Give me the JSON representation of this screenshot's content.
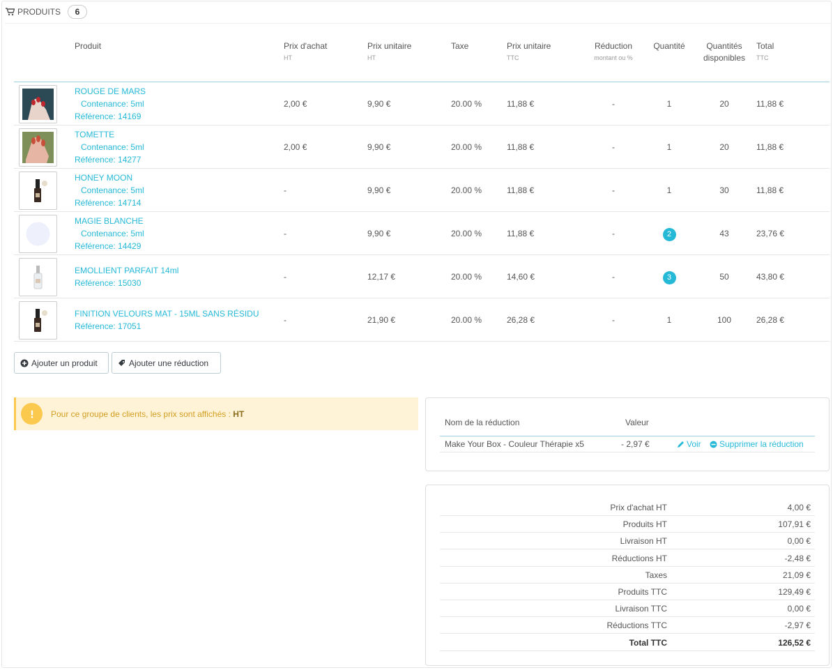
{
  "panel": {
    "title": "Produits",
    "count": "6"
  },
  "columns": {
    "product": "Produit",
    "purchase_price": "Prix d'achat",
    "purchase_price_sub": "HT",
    "unit_price_ht": "Prix unitaire",
    "unit_price_ht_sub": "HT",
    "tax": "Taxe",
    "unit_price_ttc": "Prix unitaire",
    "unit_price_ttc_sub": "TTC",
    "reduction": "Réduction",
    "reduction_sub": "montant ou %",
    "quantity": "Quantité",
    "available": "Quantités disponibles",
    "total": "Total",
    "total_sub": "TTC"
  },
  "products": [
    {
      "name": "ROUGE DE MARS",
      "variant": "Contenance: 5ml",
      "reference": "Référence: 14169",
      "purchase": "2,00 €",
      "unit_ht": "9,90 €",
      "tax": "20.00 %",
      "unit_ttc": "11,88 €",
      "reduction": "-",
      "qty": "1",
      "available": "20",
      "total": "11,88 €",
      "image": "nails-red"
    },
    {
      "name": "TOMETTE",
      "variant": "Contenance: 5ml",
      "reference": "Référence: 14277",
      "purchase": "2,00 €",
      "unit_ht": "9,90 €",
      "tax": "20.00 %",
      "unit_ttc": "11,88 €",
      "reduction": "-",
      "qty": "1",
      "available": "20",
      "total": "11,88 €",
      "image": "nails-terracotta"
    },
    {
      "name": "HONEY MOON",
      "variant": "Contenance: 5ml",
      "reference": "Référence: 14714",
      "purchase": "-",
      "unit_ht": "9,90 €",
      "tax": "20.00 %",
      "unit_ttc": "11,88 €",
      "reduction": "-",
      "qty": "1",
      "available": "30",
      "total": "11,88 €",
      "image": "bottle-dark"
    },
    {
      "name": "MAGIE BLANCHE",
      "variant": "Contenance: 5ml",
      "reference": "Référence: 14429",
      "purchase": "-",
      "unit_ht": "9,90 €",
      "tax": "20.00 %",
      "unit_ttc": "11,88 €",
      "reduction": "-",
      "qty": "2",
      "available": "43",
      "total": "23,76 €",
      "image": "white-disc"
    },
    {
      "name": "EMOLLIENT PARFAIT 14ml",
      "variant": "",
      "reference": "Référence: 15030",
      "purchase": "-",
      "unit_ht": "12,17 €",
      "tax": "20.00 %",
      "unit_ttc": "14,60 €",
      "reduction": "-",
      "qty": "3",
      "available": "50",
      "total": "43,80 €",
      "image": "bottle-clear"
    },
    {
      "name": "FINITION VELOURS MAT - 15ML SANS RÉSIDU",
      "variant": "",
      "reference": "Référence: 17051",
      "purchase": "-",
      "unit_ht": "21,90 €",
      "tax": "20.00 %",
      "unit_ttc": "26,28 €",
      "reduction": "-",
      "qty": "1",
      "available": "100",
      "total": "26,28 €",
      "image": "bottle-dark"
    }
  ],
  "buttons": {
    "add_product": "Ajouter un produit",
    "add_discount": "Ajouter une réduction"
  },
  "alert": {
    "text": "Pour ce groupe de clients, les prix sont affichés : ",
    "strong": "HT"
  },
  "discounts": {
    "col_name": "Nom de la réduction",
    "col_value": "Valeur",
    "rows": [
      {
        "name": "Make Your Box - Couleur Thérapie x5",
        "value": "- 2,97 €",
        "view": "Voir",
        "delete": "Supprimer la réduction"
      }
    ]
  },
  "totals": [
    {
      "label": "Prix d'achat HT",
      "value": "4,00 €"
    },
    {
      "label": "Produits HT",
      "value": "107,91 €"
    },
    {
      "label": "Livraison HT",
      "value": "0,00 €"
    },
    {
      "label": "Réductions HT",
      "value": "-2,48 €"
    },
    {
      "label": "Taxes",
      "value": "21,09 €"
    },
    {
      "label": "Produits TTC",
      "value": "129,49 €"
    },
    {
      "label": "Livraison TTC",
      "value": "0,00 €"
    },
    {
      "label": "Réductions TTC",
      "value": "-2,97 €"
    },
    {
      "label": "Total TTC",
      "value": "126,52 €"
    }
  ],
  "colors": {
    "accent": "#25b9d7",
    "warning_bg": "#fff3d7",
    "warning_text": "#d19e20",
    "warning_icon": "#fcc94f"
  }
}
